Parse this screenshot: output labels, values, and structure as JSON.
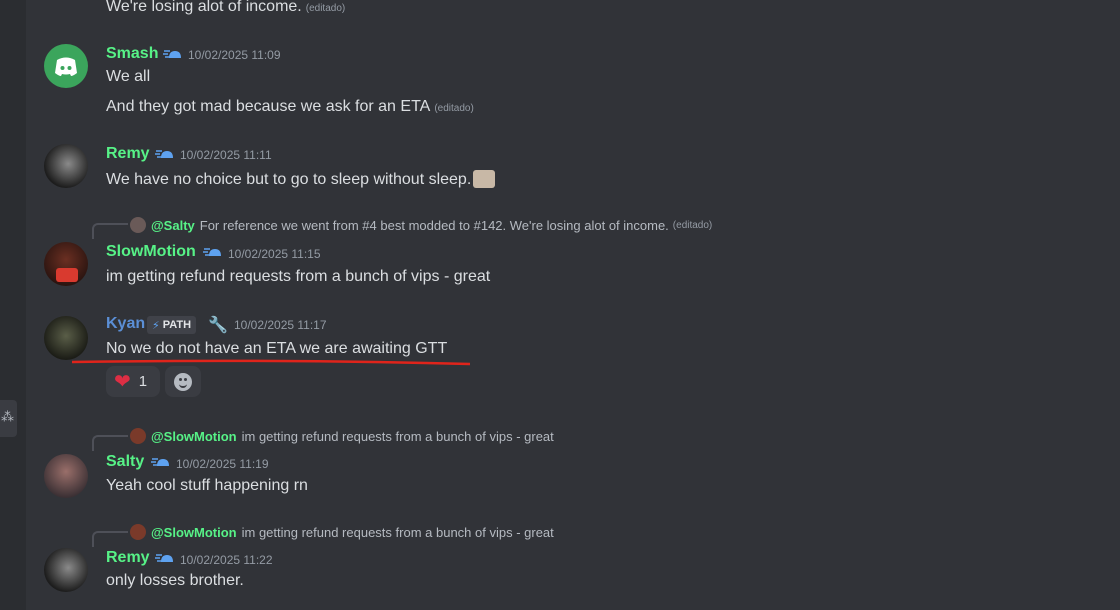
{
  "top_line": {
    "text": "We're losing alot of income.",
    "edited": "(editado)"
  },
  "messages": [
    {
      "user": "Smash",
      "timestamp": "10/02/2025 11:09",
      "lines": [
        "We all",
        "And they got mad  because we ask for an ETA"
      ],
      "edited": "(editado)"
    },
    {
      "user": "Remy",
      "timestamp": "10/02/2025 11:11",
      "lines": [
        "We have no choice but to go to sleep without sleep."
      ]
    },
    {
      "reply_to": "@Salty",
      "reply_text": "For reference we went from #4 best modded to #142.  We're losing alot of income.",
      "reply_edited": "(editado)",
      "user": "SlowMotion",
      "timestamp": "10/02/2025 11:15",
      "lines": [
        "im getting refund requests from a bunch of vips - great"
      ]
    },
    {
      "user": "Kyan",
      "tag": "PATH",
      "timestamp": "10/02/2025 11:17",
      "lines": [
        "No we do not have an ETA we are awaiting GTT"
      ],
      "reactions": [
        {
          "emoji": "heart",
          "count": "1"
        }
      ]
    },
    {
      "reply_to": "@SlowMotion",
      "reply_text": "im getting refund requests from a bunch of vips - great",
      "user": "Salty",
      "timestamp": "10/02/2025 11:19",
      "lines": [
        "Yeah cool stuff happening rn"
      ]
    },
    {
      "reply_to": "@SlowMotion",
      "reply_text": "im getting refund requests from a bunch of vips - great",
      "user": "Remy",
      "timestamp": "10/02/2025 11:22",
      "lines": [
        "only losses brother."
      ]
    }
  ],
  "colors": {
    "background": "#313338",
    "username_green": "#57f287",
    "username_blue": "#5b8fd6",
    "underline_red": "#e0241b"
  }
}
